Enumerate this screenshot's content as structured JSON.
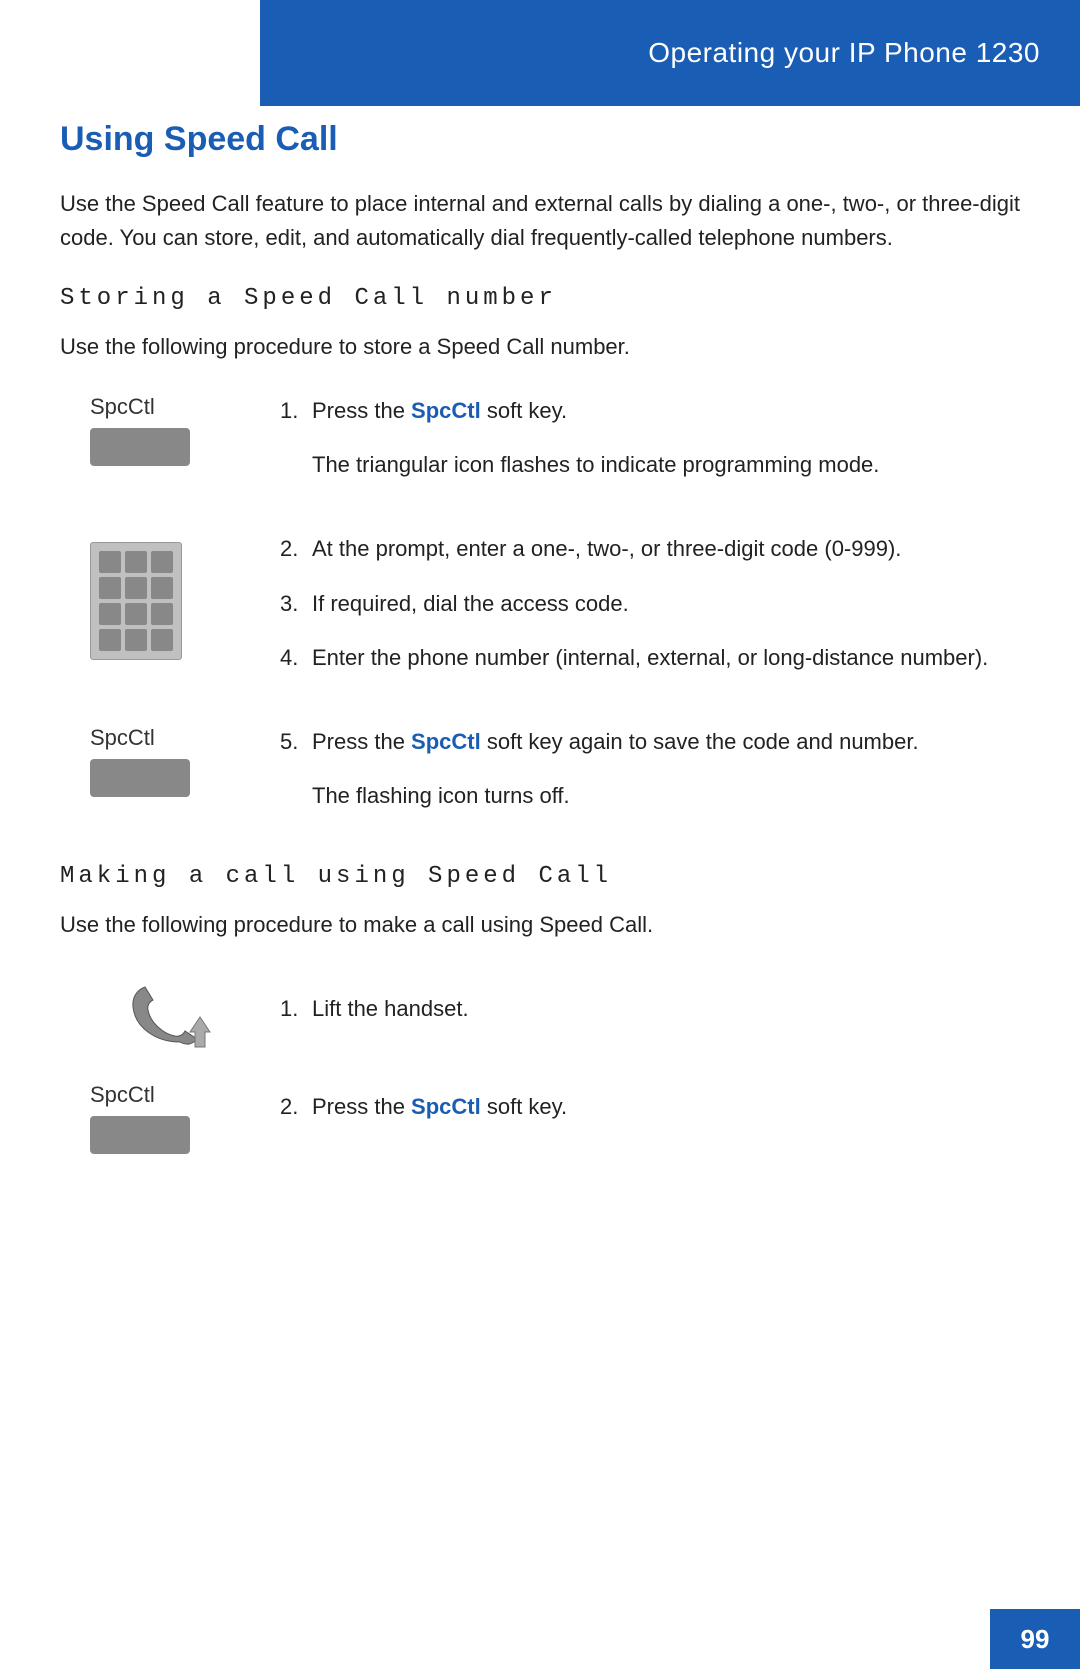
{
  "header": {
    "title_plain": "Operating your IP Phone ",
    "title_bold": "1230",
    "full_title": "Operating your IP Phone 1230"
  },
  "section": {
    "title": "Using Speed Call",
    "intro": "Use the Speed Call feature to place internal and external calls by dialing a one-, two-, or three-digit code. You can store, edit, and automatically dial frequently-called telephone numbers.",
    "subsection1": {
      "title": "Storing a Speed Call number",
      "intro": "Use the following procedure to store a Speed Call number.",
      "steps": [
        {
          "number": "1.",
          "icon_label": "SpcCtl",
          "icon_type": "softkey",
          "text_before_bold": "Press the ",
          "bold": "SpcCtl",
          "text_after_bold": " soft key.",
          "subnote": "The triangular icon flashes to indicate programming mode."
        },
        {
          "number": "2.",
          "icon_type": "keypad",
          "text_before_bold": "At the prompt, enter a one-, two-, or three-digit code (0-999).",
          "bold": "",
          "text_after_bold": ""
        },
        {
          "number": "3.",
          "text": "If required, dial the access code."
        },
        {
          "number": "4.",
          "text": "Enter the phone number (internal, external, or long-distance number)."
        },
        {
          "number": "5.",
          "icon_label": "SpcCtl",
          "icon_type": "softkey",
          "text_before_bold": "Press the ",
          "bold": "SpcCtl",
          "text_after_bold": " soft key again to save the code and number.",
          "subnote": "The flashing icon turns off."
        }
      ]
    },
    "subsection2": {
      "title": "Making a call using Speed Call",
      "intro": "Use the following procedure to make a call using Speed Call.",
      "steps": [
        {
          "number": "1.",
          "icon_type": "handset",
          "text": "Lift the handset."
        },
        {
          "number": "2.",
          "icon_label": "SpcCtl",
          "icon_type": "softkey",
          "text_before_bold": "Press the ",
          "bold": "SpcCtl",
          "text_after_bold": " soft key."
        }
      ]
    }
  },
  "footer": {
    "page_number": "99"
  }
}
